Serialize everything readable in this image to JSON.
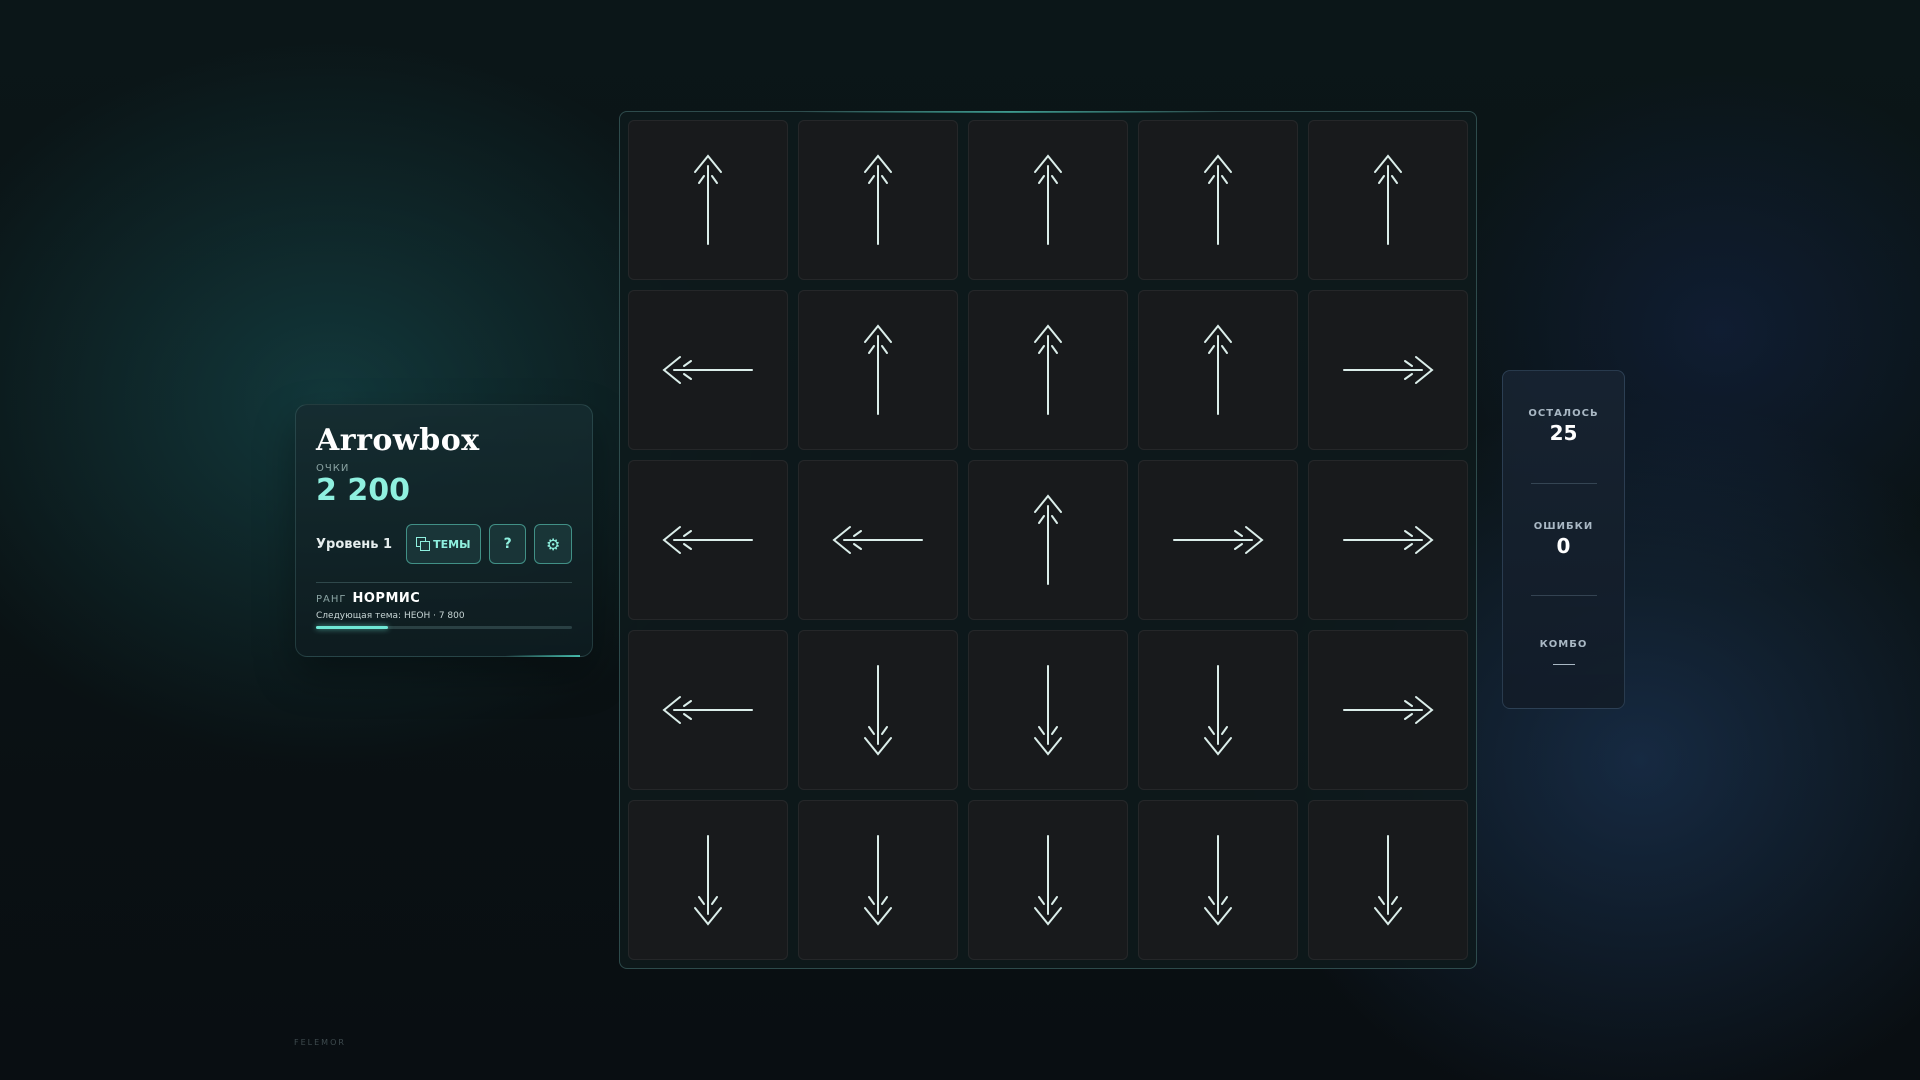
{
  "app": {
    "title": "Arrowbox"
  },
  "score": {
    "label": "ОЧКИ",
    "value": "2 200"
  },
  "controls": {
    "level_label": "Уровень 1",
    "themes_label": "ТЕМЫ",
    "help_label": "?",
    "settings_label": "⚙"
  },
  "rank": {
    "label": "РАНГ",
    "value": "НОРМИС",
    "next_theme": "Следующая тема: НЕОН · 7 800",
    "progress": 0.28
  },
  "stats": {
    "remaining_label": "ОСТАЛОСЬ",
    "remaining_value": "25",
    "errors_label": "ОШИБКИ",
    "errors_value": "0",
    "combo_label": "КОМБО"
  },
  "colors": {
    "accent": "#6fe8d6",
    "arrow_stroke": "#dbeeea"
  },
  "board": {
    "rows": 5,
    "cols": 5,
    "tiles": [
      [
        "up",
        "up",
        "up",
        "up",
        "up"
      ],
      [
        "left",
        "up",
        "up",
        "up",
        "right"
      ],
      [
        "left",
        "left",
        "up",
        "right",
        "right"
      ],
      [
        "left",
        "down",
        "down",
        "down",
        "right"
      ],
      [
        "down",
        "down",
        "down",
        "down",
        "down"
      ]
    ]
  },
  "footer": {
    "mark": "FELEMOR"
  }
}
